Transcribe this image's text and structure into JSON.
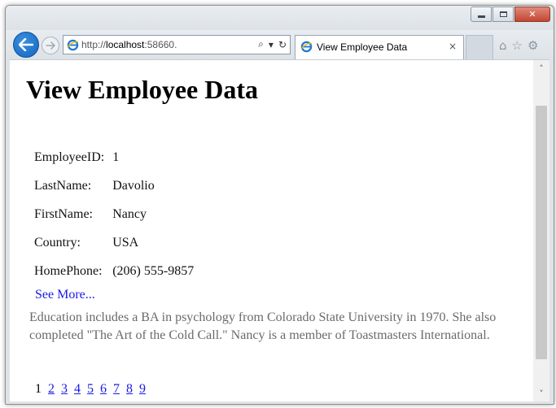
{
  "browser": {
    "address_url_prefix": "http://",
    "address_url_host": "localhost",
    "address_url_rest": ":58660.",
    "search_glyph": "⌕",
    "dropdown_glyph": "▾",
    "refresh_glyph": "↻",
    "tab_title": "View Employee Data",
    "tab_close": "×",
    "home_glyph": "⌂",
    "favorites_glyph": "☆",
    "settings_glyph": "⚙",
    "close_glyph": "✕"
  },
  "page": {
    "title": "View Employee Data",
    "fields": [
      {
        "label": "EmployeeID:",
        "value": "1"
      },
      {
        "label": "LastName:",
        "value": "Davolio"
      },
      {
        "label": "FirstName:",
        "value": "Nancy"
      },
      {
        "label": "Country:",
        "value": "USA"
      },
      {
        "label": "HomePhone:",
        "value": "(206) 555-9857"
      }
    ],
    "see_more": "See More...",
    "notes": "Education includes a BA in psychology from Colorado State University in 1970. She also completed \"The Art of the Cold Call.\" Nancy is a member of Toastmasters International.",
    "pager": {
      "current": "1",
      "links": [
        "2",
        "3",
        "4",
        "5",
        "6",
        "7",
        "8",
        "9"
      ]
    }
  },
  "scrollbar": {
    "up_glyph": "˄",
    "down_glyph": "˅"
  },
  "colors": {
    "link": "#1a1ae6",
    "notes_text": "#6a6a6a",
    "back_button": "#1466c0",
    "close_button": "#c24632"
  }
}
